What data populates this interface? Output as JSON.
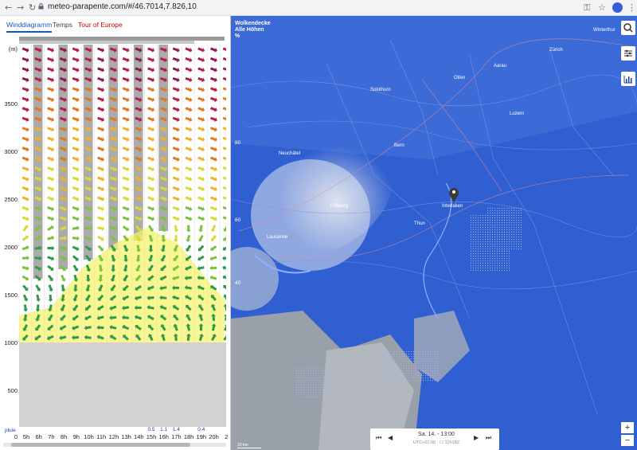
{
  "browser": {
    "url": "meteo-parapente.com/#/46.7014,7.826,10",
    "back_icon": "arrow-left",
    "forward_icon": "arrow-right",
    "reload_icon": "reload",
    "key_icon": "key",
    "star_icon": "star",
    "menu_icon": "kebab"
  },
  "tabs": [
    {
      "label": "Winddiagramm",
      "active": true
    },
    {
      "label": "Temps",
      "active": false
    },
    {
      "label": "Tour of Europe",
      "active": false
    }
  ],
  "diagram": {
    "unit": "(m)",
    "y_labels": [
      "3500",
      "3000",
      "2500",
      "2000",
      "1500",
      "1000",
      "500",
      "0"
    ],
    "hours": [
      "5h",
      "6h",
      "7h",
      "8h",
      "9h",
      "10h",
      "11h",
      "12h",
      "13h",
      "14h",
      "15h",
      "16h",
      "17h",
      "18h",
      "19h",
      "20h",
      "2"
    ],
    "rain_label": "pluie",
    "rain": [
      "",
      "",
      "",
      "",
      "",
      "",
      "",
      "",
      "",
      "",
      "0.5",
      "1.1",
      "1.4",
      "",
      "0.4",
      "",
      ""
    ]
  },
  "map": {
    "title_line1": "Wolkendecke",
    "title_line2": "Alle Höhen",
    "title_line3": "%",
    "legend": [
      "80",
      "60",
      "40"
    ],
    "cities": [
      "Bern",
      "Lausanne",
      "Fribourg",
      "Luzern",
      "Zürich",
      "Winterthur",
      "Solothurn",
      "Neuchâtel",
      "Interlaken",
      "Thun",
      "Aarau",
      "Olten"
    ],
    "scale": "20 km",
    "zoom_in": "+",
    "zoom_out": "−",
    "time_date": "Sa. 14. - 13:00",
    "time_sub": "UTC+01:00 · ☐ 12h18Z",
    "tools": [
      "search-icon",
      "sliders-icon",
      "chart-icon"
    ]
  }
}
